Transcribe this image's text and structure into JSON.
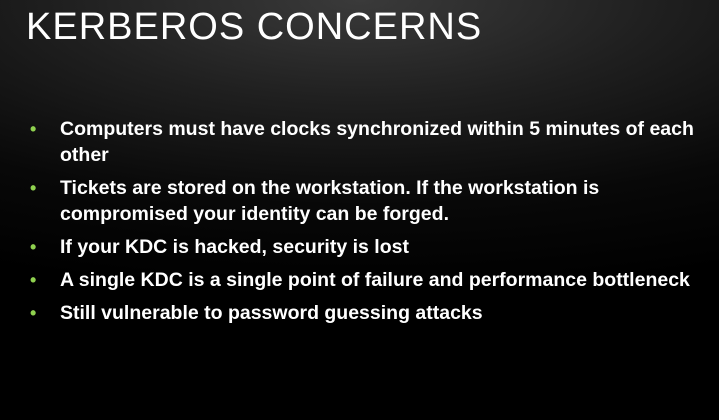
{
  "slide": {
    "title": "KERBEROS CONCERNS",
    "bullet_color": "#8fd14f",
    "bullet_glyph": "•",
    "bullets": [
      "Computers must have clocks synchronized within 5 minutes of each other",
      "Tickets are stored on the workstation. If the workstation is compromised your identity can be forged.",
      "If your KDC is hacked, security is lost",
      "A single KDC is a single point of failure and performance bottleneck",
      "Still vulnerable to password guessing attacks"
    ]
  }
}
